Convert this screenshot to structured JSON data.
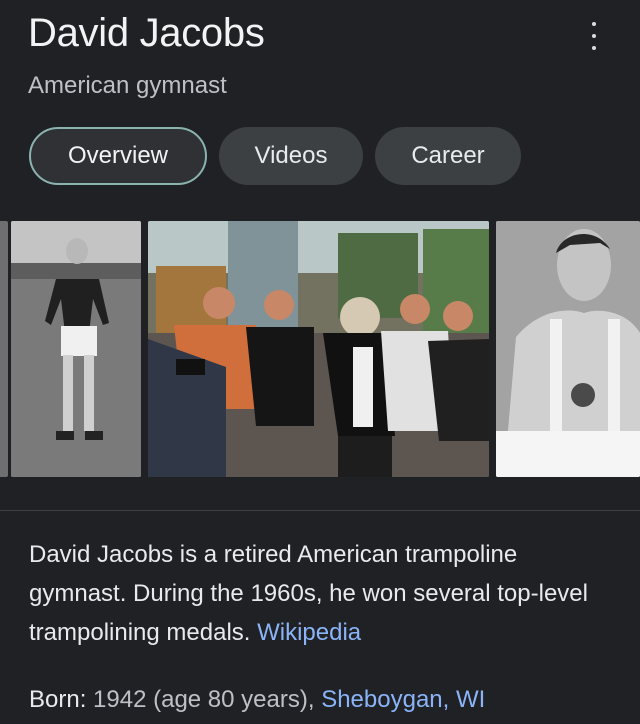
{
  "header": {
    "title": "David Jacobs",
    "subtitle": "American gymnast",
    "menu_icon": "more-vertical-icon"
  },
  "tabs": [
    {
      "label": "Overview",
      "active": true
    },
    {
      "label": "Videos",
      "active": false
    },
    {
      "label": "Career",
      "active": false
    }
  ],
  "images": [
    {
      "name": "black-white-gymnast-photo"
    },
    {
      "name": "market-group-photo"
    },
    {
      "name": "black-white-portrait-photo"
    }
  ],
  "description": {
    "text": "David Jacobs is a retired American trampoline gymnast. During the 1960s, he won several top-level trampolining medals.",
    "source": "Wikipedia"
  },
  "facts": {
    "born": {
      "label": "Born:",
      "value": "1942 (age 80 years),",
      "place": "Sheboygan, WI"
    }
  },
  "colors": {
    "background": "#202124",
    "link": "#8ab4f8",
    "chip": "#3c4043",
    "active_chip_border": "#8ab4b0"
  }
}
